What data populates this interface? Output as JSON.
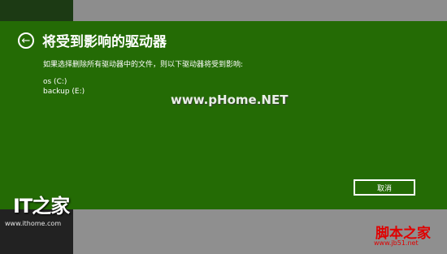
{
  "dialog": {
    "back_icon": "back-arrow-icon",
    "title": "将受到影响的驱动器",
    "message": "如果选择删除所有驱动器中的文件，则以下驱动器将受到影响:",
    "drives": [
      "os (C:)",
      "backup (E:)"
    ],
    "cancel_label": "取消",
    "background_color": "#246b05"
  },
  "watermarks": {
    "center": "www.pHome.NET",
    "left_logo": "IT之家",
    "left_url": "www.ithome.com",
    "right_logo": "脚本之家",
    "right_url": "www.jb51.net"
  }
}
